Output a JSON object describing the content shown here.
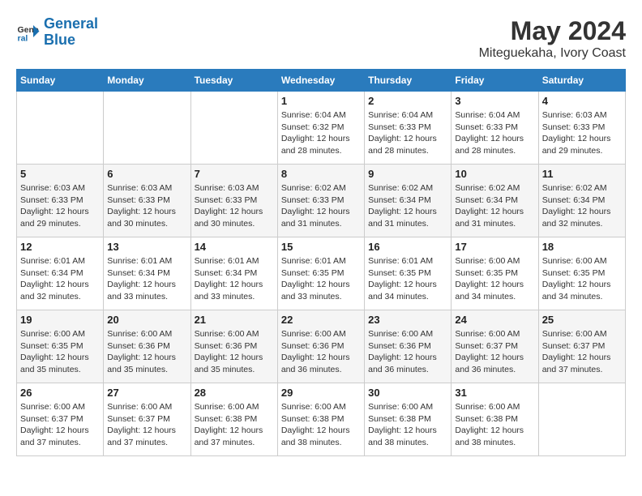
{
  "logo": {
    "line1": "General",
    "line2": "Blue"
  },
  "title": "May 2024",
  "location": "Miteguekaha, Ivory Coast",
  "days_header": [
    "Sunday",
    "Monday",
    "Tuesday",
    "Wednesday",
    "Thursday",
    "Friday",
    "Saturday"
  ],
  "weeks": [
    [
      {
        "day": "",
        "sunrise": "",
        "sunset": "",
        "daylight": ""
      },
      {
        "day": "",
        "sunrise": "",
        "sunset": "",
        "daylight": ""
      },
      {
        "day": "",
        "sunrise": "",
        "sunset": "",
        "daylight": ""
      },
      {
        "day": "1",
        "sunrise": "Sunrise: 6:04 AM",
        "sunset": "Sunset: 6:32 PM",
        "daylight": "Daylight: 12 hours and 28 minutes."
      },
      {
        "day": "2",
        "sunrise": "Sunrise: 6:04 AM",
        "sunset": "Sunset: 6:33 PM",
        "daylight": "Daylight: 12 hours and 28 minutes."
      },
      {
        "day": "3",
        "sunrise": "Sunrise: 6:04 AM",
        "sunset": "Sunset: 6:33 PM",
        "daylight": "Daylight: 12 hours and 28 minutes."
      },
      {
        "day": "4",
        "sunrise": "Sunrise: 6:03 AM",
        "sunset": "Sunset: 6:33 PM",
        "daylight": "Daylight: 12 hours and 29 minutes."
      }
    ],
    [
      {
        "day": "5",
        "sunrise": "Sunrise: 6:03 AM",
        "sunset": "Sunset: 6:33 PM",
        "daylight": "Daylight: 12 hours and 29 minutes."
      },
      {
        "day": "6",
        "sunrise": "Sunrise: 6:03 AM",
        "sunset": "Sunset: 6:33 PM",
        "daylight": "Daylight: 12 hours and 30 minutes."
      },
      {
        "day": "7",
        "sunrise": "Sunrise: 6:03 AM",
        "sunset": "Sunset: 6:33 PM",
        "daylight": "Daylight: 12 hours and 30 minutes."
      },
      {
        "day": "8",
        "sunrise": "Sunrise: 6:02 AM",
        "sunset": "Sunset: 6:33 PM",
        "daylight": "Daylight: 12 hours and 31 minutes."
      },
      {
        "day": "9",
        "sunrise": "Sunrise: 6:02 AM",
        "sunset": "Sunset: 6:34 PM",
        "daylight": "Daylight: 12 hours and 31 minutes."
      },
      {
        "day": "10",
        "sunrise": "Sunrise: 6:02 AM",
        "sunset": "Sunset: 6:34 PM",
        "daylight": "Daylight: 12 hours and 31 minutes."
      },
      {
        "day": "11",
        "sunrise": "Sunrise: 6:02 AM",
        "sunset": "Sunset: 6:34 PM",
        "daylight": "Daylight: 12 hours and 32 minutes."
      }
    ],
    [
      {
        "day": "12",
        "sunrise": "Sunrise: 6:01 AM",
        "sunset": "Sunset: 6:34 PM",
        "daylight": "Daylight: 12 hours and 32 minutes."
      },
      {
        "day": "13",
        "sunrise": "Sunrise: 6:01 AM",
        "sunset": "Sunset: 6:34 PM",
        "daylight": "Daylight: 12 hours and 33 minutes."
      },
      {
        "day": "14",
        "sunrise": "Sunrise: 6:01 AM",
        "sunset": "Sunset: 6:34 PM",
        "daylight": "Daylight: 12 hours and 33 minutes."
      },
      {
        "day": "15",
        "sunrise": "Sunrise: 6:01 AM",
        "sunset": "Sunset: 6:35 PM",
        "daylight": "Daylight: 12 hours and 33 minutes."
      },
      {
        "day": "16",
        "sunrise": "Sunrise: 6:01 AM",
        "sunset": "Sunset: 6:35 PM",
        "daylight": "Daylight: 12 hours and 34 minutes."
      },
      {
        "day": "17",
        "sunrise": "Sunrise: 6:00 AM",
        "sunset": "Sunset: 6:35 PM",
        "daylight": "Daylight: 12 hours and 34 minutes."
      },
      {
        "day": "18",
        "sunrise": "Sunrise: 6:00 AM",
        "sunset": "Sunset: 6:35 PM",
        "daylight": "Daylight: 12 hours and 34 minutes."
      }
    ],
    [
      {
        "day": "19",
        "sunrise": "Sunrise: 6:00 AM",
        "sunset": "Sunset: 6:35 PM",
        "daylight": "Daylight: 12 hours and 35 minutes."
      },
      {
        "day": "20",
        "sunrise": "Sunrise: 6:00 AM",
        "sunset": "Sunset: 6:36 PM",
        "daylight": "Daylight: 12 hours and 35 minutes."
      },
      {
        "day": "21",
        "sunrise": "Sunrise: 6:00 AM",
        "sunset": "Sunset: 6:36 PM",
        "daylight": "Daylight: 12 hours and 35 minutes."
      },
      {
        "day": "22",
        "sunrise": "Sunrise: 6:00 AM",
        "sunset": "Sunset: 6:36 PM",
        "daylight": "Daylight: 12 hours and 36 minutes."
      },
      {
        "day": "23",
        "sunrise": "Sunrise: 6:00 AM",
        "sunset": "Sunset: 6:36 PM",
        "daylight": "Daylight: 12 hours and 36 minutes."
      },
      {
        "day": "24",
        "sunrise": "Sunrise: 6:00 AM",
        "sunset": "Sunset: 6:37 PM",
        "daylight": "Daylight: 12 hours and 36 minutes."
      },
      {
        "day": "25",
        "sunrise": "Sunrise: 6:00 AM",
        "sunset": "Sunset: 6:37 PM",
        "daylight": "Daylight: 12 hours and 37 minutes."
      }
    ],
    [
      {
        "day": "26",
        "sunrise": "Sunrise: 6:00 AM",
        "sunset": "Sunset: 6:37 PM",
        "daylight": "Daylight: 12 hours and 37 minutes."
      },
      {
        "day": "27",
        "sunrise": "Sunrise: 6:00 AM",
        "sunset": "Sunset: 6:37 PM",
        "daylight": "Daylight: 12 hours and 37 minutes."
      },
      {
        "day": "28",
        "sunrise": "Sunrise: 6:00 AM",
        "sunset": "Sunset: 6:38 PM",
        "daylight": "Daylight: 12 hours and 37 minutes."
      },
      {
        "day": "29",
        "sunrise": "Sunrise: 6:00 AM",
        "sunset": "Sunset: 6:38 PM",
        "daylight": "Daylight: 12 hours and 38 minutes."
      },
      {
        "day": "30",
        "sunrise": "Sunrise: 6:00 AM",
        "sunset": "Sunset: 6:38 PM",
        "daylight": "Daylight: 12 hours and 38 minutes."
      },
      {
        "day": "31",
        "sunrise": "Sunrise: 6:00 AM",
        "sunset": "Sunset: 6:38 PM",
        "daylight": "Daylight: 12 hours and 38 minutes."
      },
      {
        "day": "",
        "sunrise": "",
        "sunset": "",
        "daylight": ""
      }
    ]
  ]
}
